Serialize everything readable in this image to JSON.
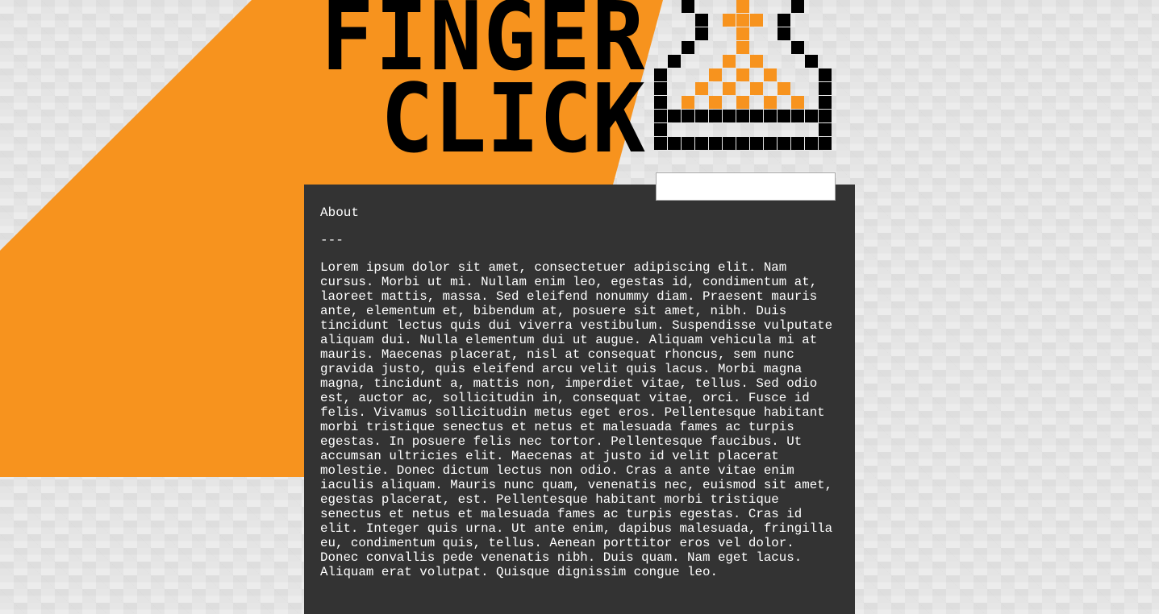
{
  "colors": {
    "accent": "#f7931e",
    "panel": "#333333",
    "text": "#ffffff",
    "background": "#e6e6e6",
    "logo": "#000000"
  },
  "logo": {
    "line1": "FINGER",
    "line2": "CLICK",
    "icon": "hourglass-icon"
  },
  "search": {
    "value": "",
    "placeholder": ""
  },
  "content": {
    "title": "About",
    "divider": "---",
    "body": "Lorem ipsum dolor sit amet, consectetuer adipiscing elit. Nam cursus. Morbi ut mi. Nullam enim leo, egestas id, condimentum at, laoreet mattis, massa. Sed eleifend nonummy diam. Praesent mauris ante, elementum et, bibendum at, posuere sit amet, nibh. Duis tincidunt lectus quis dui viverra vestibulum. Suspendisse vulputate aliquam dui. Nulla elementum dui ut augue. Aliquam vehicula mi at mauris. Maecenas placerat, nisl at consequat rhoncus, sem nunc gravida justo, quis eleifend arcu velit quis lacus. Morbi magna magna, tincidunt a, mattis non, imperdiet vitae, tellus. Sed odio est, auctor ac, sollicitudin in, consequat vitae, orci. Fusce id felis. Vivamus sollicitudin metus eget eros. Pellentesque habitant morbi tristique senectus et netus et malesuada fames ac turpis egestas. In posuere felis nec tortor. Pellentesque faucibus. Ut accumsan ultricies elit. Maecenas at justo id velit placerat molestie. Donec dictum lectus non odio. Cras a ante vitae enim iaculis aliquam. Mauris nunc quam, venenatis nec, euismod sit amet, egestas placerat, est. Pellentesque habitant morbi tristique senectus et netus et malesuada fames ac turpis egestas. Cras id elit. Integer quis urna. Ut ante enim, dapibus malesuada, fringilla eu, condimentum quis, tellus. Aenean porttitor eros vel dolor. Donec convallis pede venenatis nibh. Duis quam. Nam eget lacus. Aliquam erat volutpat. Quisque dignissim congue leo."
  }
}
